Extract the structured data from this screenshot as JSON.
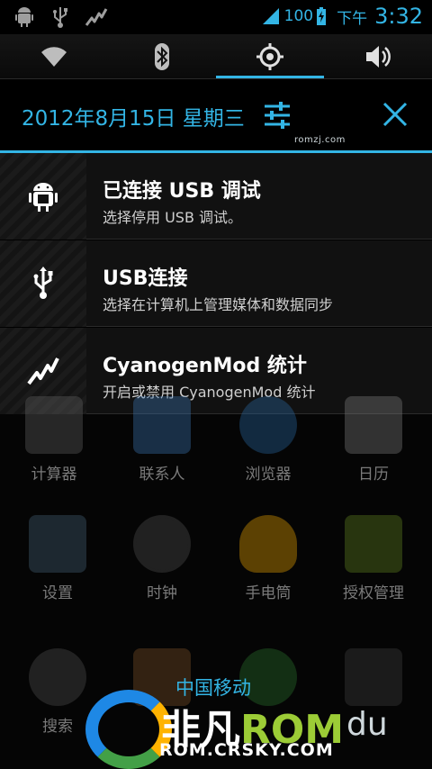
{
  "status_bar": {
    "left_icons": [
      "android-debug-icon",
      "usb-icon",
      "stats-icon"
    ],
    "battery": "100",
    "ampm": "下午",
    "time": "3:32"
  },
  "toggles": [
    {
      "name": "wifi",
      "active": false
    },
    {
      "name": "bluetooth",
      "active": false
    },
    {
      "name": "gps",
      "active": true
    },
    {
      "name": "sound",
      "active": false
    }
  ],
  "header": {
    "date": "2012年8月15日 星期三",
    "watermark": "romzj.com"
  },
  "notifications": [
    {
      "icon": "android-debug-icon",
      "title": "已连接 USB 调试",
      "subtitle": "选择停用 USB 调试。"
    },
    {
      "icon": "usb-icon",
      "title": "USB连接",
      "subtitle": "选择在计算机上管理媒体和数据同步"
    },
    {
      "icon": "stats-icon",
      "title": "CyanogenMod 统计",
      "subtitle": "开启或禁用 CyanogenMod 统计"
    }
  ],
  "apps": [
    {
      "label": "计算器",
      "color": "#666666"
    },
    {
      "label": "联系人",
      "color": "#3f7fbf"
    },
    {
      "label": "浏览器",
      "color": "#2a6fb0"
    },
    {
      "label": "日历",
      "color": "#888888"
    },
    {
      "label": "设置",
      "color": "#4a6a80"
    },
    {
      "label": "时钟",
      "color": "#555555"
    },
    {
      "label": "手电筒",
      "color": "#ffb300"
    },
    {
      "label": "授权管理",
      "color": "#6b8e23"
    },
    {
      "label": "搜索",
      "color": "#555555"
    },
    {
      "label": "",
      "color": "#8a5a2b"
    },
    {
      "label": "",
      "color": "#2e7d32"
    },
    {
      "label": "",
      "color": "#444444"
    }
  ],
  "brand": {
    "carrier": "中国移动",
    "name_prefix": "非凡",
    "name_suffix": "ROM",
    "url": "ROM.CRSKY.COM",
    "extra": "du"
  },
  "colors": {
    "accent": "#33b5e5"
  }
}
